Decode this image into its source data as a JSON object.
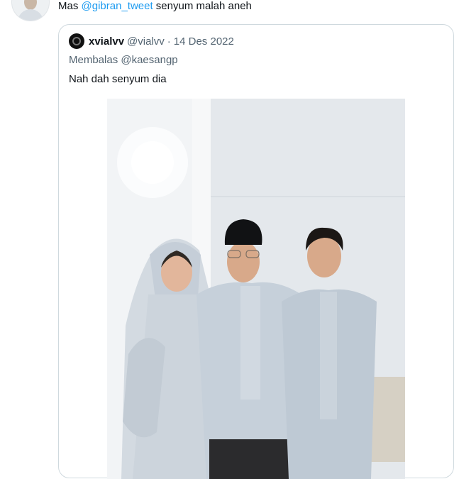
{
  "reply": {
    "prefix": "Mas ",
    "mention": "@gibran_tweet",
    "suffix": " senyum malah aneh"
  },
  "quoted_tweet": {
    "display_name": "xvialvv",
    "handle": "@vialvv",
    "separator": "·",
    "date": "14 Des 2022",
    "replying_to": "Membalas @kaesangp",
    "text": "Nah dah senyum dia"
  },
  "colors": {
    "link": "#1d9bf0",
    "secondary_text": "#536471",
    "border": "#cfd9de"
  }
}
